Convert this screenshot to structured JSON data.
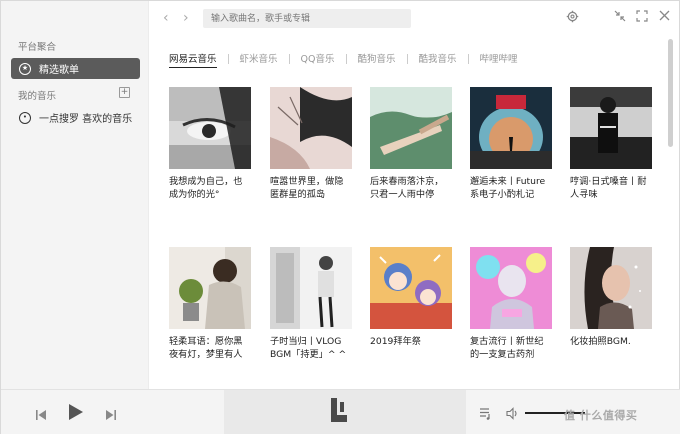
{
  "topbar": {
    "back_glyph": "‹",
    "forward_glyph": "›",
    "search_placeholder": "输入歌曲名，歌手或专辑"
  },
  "sidebar": {
    "section1": "平台聚合",
    "featured": "精选歌单",
    "section2": "我的音乐",
    "add_glyph": "+",
    "fav": "一点搜罗 喜欢的音乐"
  },
  "tabs": [
    {
      "label": "网易云音乐",
      "active": true
    },
    {
      "label": "虾米音乐",
      "active": false
    },
    {
      "label": "QQ音乐",
      "active": false
    },
    {
      "label": "酷狗音乐",
      "active": false
    },
    {
      "label": "酷我音乐",
      "active": false
    },
    {
      "label": "哔哩哔哩",
      "active": false
    }
  ],
  "playlists": [
    {
      "title": "我想成为自己，也成为你的光°",
      "art": "eye"
    },
    {
      "title": "喧嚣世界里，做隐匿群星的孤岛",
      "art": "ink"
    },
    {
      "title": "后来春雨落汴京，只君一人雨中停",
      "art": "hand"
    },
    {
      "title": "邂逅未来丨Future系电子小酌札记",
      "art": "tunnel"
    },
    {
      "title": "哼调·日式嗓音丨耐人寻味",
      "art": "metro"
    },
    {
      "title": "轻柔耳语：愿你黑夜有灯，梦里有人",
      "art": "boy"
    },
    {
      "title": "子时当归丨VLOG BGM「持更」^ ^",
      "art": "door"
    },
    {
      "title": "2019拜年祭",
      "art": "anime"
    },
    {
      "title": "复古流行丨新世纪的一支复古药剂",
      "art": "bust"
    },
    {
      "title": "化妆拍照BGM.",
      "art": "girl"
    }
  ],
  "player": {
    "watermark": "值 什么值得买"
  },
  "colors": {
    "active_bg": "#5b5b5b",
    "sidebar_bg": "#f4f4f4",
    "text": "#222222"
  }
}
